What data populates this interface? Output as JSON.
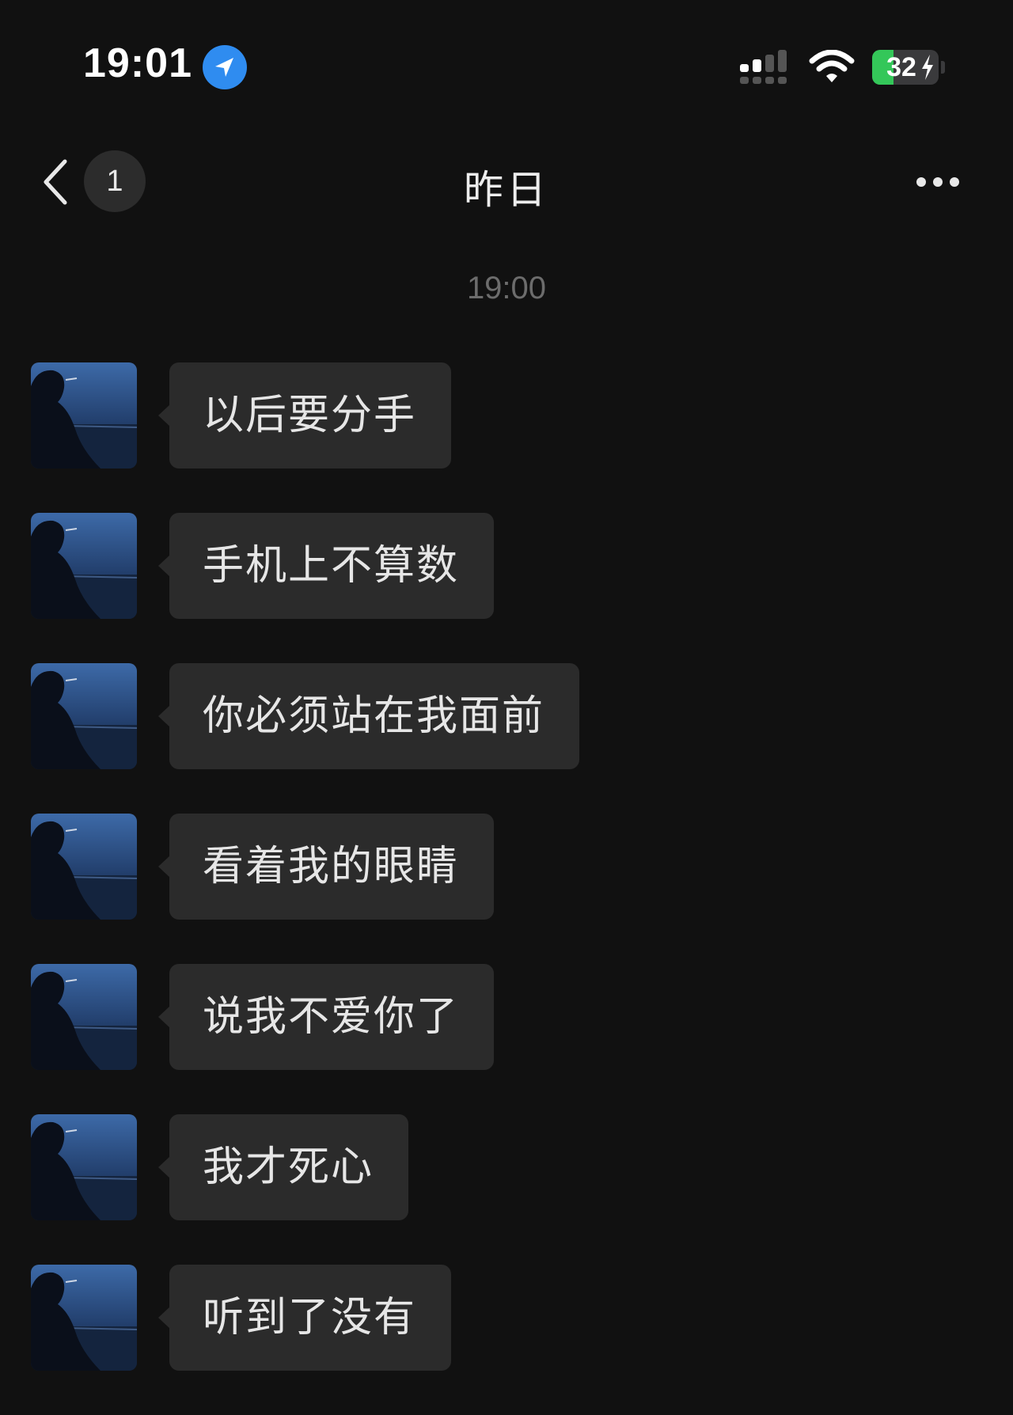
{
  "status_bar": {
    "time": "19:01",
    "location_icon": "location-arrow-icon",
    "signal_icon": "cellular-signal-icon",
    "wifi_icon": "wifi-icon",
    "battery_level": "32",
    "battery_charging": true,
    "battery_color": "#34c759"
  },
  "nav": {
    "back_icon": "chevron-left-icon",
    "unread_count": "1",
    "title": "昨日",
    "more_icon": "more-dots-icon"
  },
  "chat": {
    "timestamp": "19:00",
    "bubble_color": "#2b2b2b",
    "background_color": "#111111",
    "messages": [
      {
        "sender": "contact",
        "text": "以后要分手"
      },
      {
        "sender": "contact",
        "text": "手机上不算数"
      },
      {
        "sender": "contact",
        "text": "你必须站在我面前"
      },
      {
        "sender": "contact",
        "text": "看着我的眼睛"
      },
      {
        "sender": "contact",
        "text": "说我不爱你了"
      },
      {
        "sender": "contact",
        "text": "我才死心"
      },
      {
        "sender": "contact",
        "text": "听到了没有"
      }
    ]
  }
}
